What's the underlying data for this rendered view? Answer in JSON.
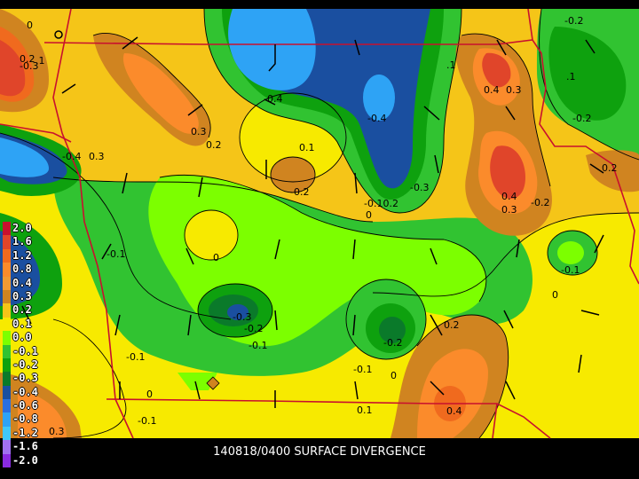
{
  "map": {
    "caption": "140818/0400 SURFACE DIVERGENCE",
    "legend": [
      {
        "label": "2.0",
        "color": "#c8102e"
      },
      {
        "label": "1.6",
        "color": "#e0452a"
      },
      {
        "label": "1.2",
        "color": "#f06a1e"
      },
      {
        "label": "0.8",
        "color": "#fb8b2b"
      },
      {
        "label": "0.4",
        "color": "#f19a33"
      },
      {
        "label": "0.3",
        "color": "#d08420"
      },
      {
        "label": "0.2",
        "color": "#f5c518"
      },
      {
        "label": "0.1",
        "color": "#f7ea00"
      },
      {
        "label": "0.0",
        "color": "#7cff00"
      },
      {
        "label": "-0.1",
        "color": "#31c331"
      },
      {
        "label": "-0.2",
        "color": "#0ea10e"
      },
      {
        "label": "-0.3",
        "color": "#0a7a2a"
      },
      {
        "label": "-0.4",
        "color": "#1a4fa0"
      },
      {
        "label": "-0.6",
        "color": "#2b6fe0"
      },
      {
        "label": "-0.8",
        "color": "#2ea3f5"
      },
      {
        "label": "-1.2",
        "color": "#40c8f8"
      },
      {
        "label": "-1.6",
        "color": "#a070f0"
      },
      {
        "label": "-2.0",
        "color": "#8a2be2"
      }
    ],
    "contour_labels": [
      "0",
      ".1",
      "-0.1",
      "0.2",
      "-0.2",
      "0.3",
      "-0.3",
      "0.4",
      "-0.4",
      "-0.10.2",
      "0.1"
    ]
  }
}
